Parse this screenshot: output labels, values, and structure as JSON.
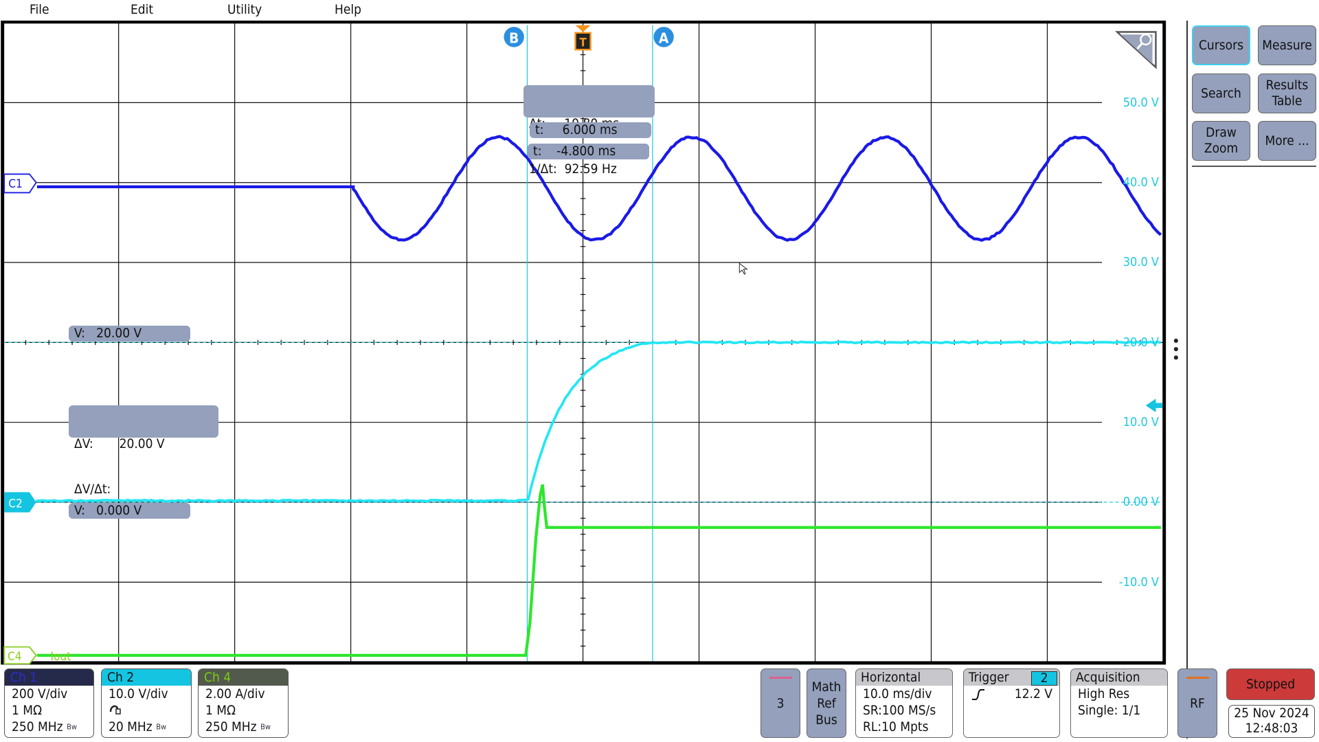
{
  "menu": {
    "items": [
      "File",
      "Edit",
      "Utility",
      "Help"
    ]
  },
  "graticule": {
    "voltage_labels": [
      "50.0 V",
      "40.0 V",
      "30.0 V",
      "20.0 V",
      "10.0 V",
      "0.00 V",
      "-10.0 V"
    ],
    "cursor_a_label": "A",
    "cursor_b_label": "B",
    "trigger_marker": "T",
    "channel_markers": {
      "c1": "C1",
      "c2": "C2",
      "c4": "C4",
      "c4_name": "Iout"
    }
  },
  "readouts": {
    "delta_t": "Δt:     10.80 ms",
    "inv_delta_t": "1/Δt:  92.59 Hz",
    "t_a": "t:     6.000 ms",
    "t_b": "t:    -4.800 ms",
    "v_a": "V:   20.00 V",
    "delta_v": "ΔV:       20.00 V",
    "delta_v_dt": "ΔV/Δt:",
    "v_b": "V:   0.000 V"
  },
  "side_panel": {
    "buttons": [
      "Cursors",
      "Measure",
      "Search",
      "Results\nTable",
      "Draw\nZoom",
      "More ..."
    ]
  },
  "channels": [
    {
      "name": "Ch 1",
      "scale": "200 V/div",
      "line2": "1 MΩ",
      "bandwidth": "250 MHz",
      "color": "#2b2bd6",
      "header_bg": "#262a4a"
    },
    {
      "name": "Ch 2",
      "scale": "10.0 V/div",
      "line2": "probe",
      "bandwidth": "20 MHz",
      "color": "#111111",
      "header_bg": "#14c4e0"
    },
    {
      "name": "Ch 4",
      "scale": "2.00 A/div",
      "line2": "1 MΩ",
      "bandwidth": "250 MHz",
      "color": "#7ccc10",
      "header_bg": "#525a4e"
    }
  ],
  "bw_marker": "Bw",
  "bottom": {
    "add_channel": "3",
    "math_ref_bus": "Math\nRef\nBus",
    "horizontal": {
      "title": "Horizontal",
      "scale": "10.0 ms/div",
      "sample_rate": "SR:100 MS/s",
      "record_length": "RL:10 Mpts"
    },
    "trigger": {
      "title": "Trigger",
      "source": "2",
      "level": "12.2 V",
      "slope": "rising"
    },
    "acquisition": {
      "title": "Acquisition",
      "mode": "High Res",
      "state": "Single: 1/1"
    },
    "rf": "RF",
    "run_state": "Stopped",
    "date": "25 Nov 2024",
    "time": "12:48:03"
  },
  "colors": {
    "ch1": "#1a1ae6",
    "ch2": "#22e6f5",
    "ch4": "#2ee62e",
    "cursor": "#1ec8e0",
    "trigger": "#f7941d",
    "stopped": "#cc3a3a",
    "button": "#94a0bc"
  }
}
